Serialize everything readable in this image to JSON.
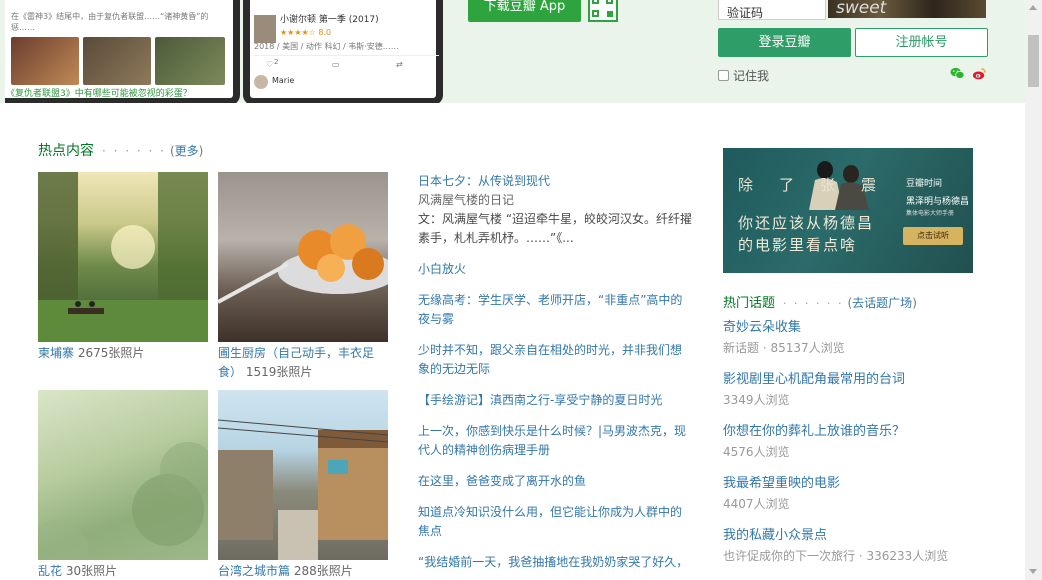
{
  "banner": {
    "phone_text_1": "在《雷神3》结尾中，由于复仇者联盟……“诸神黄昏”的惩……",
    "phone_caption": "《复仇者联盟3》中有哪些可能被忽视的彩蛋？",
    "show_title": "小谢尔顿 第一季 (2017)",
    "show_rating": "★★★★☆ 8.0",
    "show_meta": "2018 / 美国 / 动作 科幻 / 韦斯·安德……",
    "like_count": "2",
    "commenter": "Marie",
    "download_label": "下载豆瓣 App",
    "captcha_placeholder": "验证码",
    "captcha_image_text": "sweet",
    "login_label": "登录豆瓣",
    "register_label": "注册帐号",
    "remember_label": "记住我"
  },
  "hot": {
    "title": "热点内容",
    "dots": "· · · · · ·",
    "more": "更多",
    "albums": [
      {
        "name": "柬埔寨",
        "count": "2675张照片"
      },
      {
        "name": "圃生厨房（自己动手，丰衣足食）",
        "count": "1519张照片"
      },
      {
        "name": "乱花",
        "count": "30张照片"
      },
      {
        "name": "台湾之城市篇",
        "count": "288张照片"
      }
    ],
    "articles": [
      {
        "title": "日本七夕：从传说到现代",
        "author": "风满屋气楼的日记",
        "body": "文：风满屋气楼 “迢迢牵牛星，皎皎河汉女。纤纤擢素手，札札弄机杼。……”《..."
      },
      {
        "title": "小白放火"
      },
      {
        "title": "无缘高考：学生厌学、老师开店，“非重点”高中的夜与雾"
      },
      {
        "title": "少时并不知，跟父亲自在相处的时光，并非我们想象的无边无际"
      },
      {
        "title": "【手绘游记】滇西南之行-享受宁静的夏日时光"
      },
      {
        "title": "上一次，你感到快乐是什么时候？|马男波杰克，现代人的精神创伤病理手册"
      },
      {
        "title": "在这里，爸爸变成了离开水的鱼"
      },
      {
        "title": "知道点冷知识没什么用，但它能让你成为人群中的焦点"
      },
      {
        "title": "“我结婚前一天，我爸抽搐地在我奶奶家哭了好久，"
      }
    ]
  },
  "ad": {
    "chars": "除了张震",
    "line1": "你还应该从杨德昌",
    "line2": "的电影里看点啥",
    "brand": "豆瓣时间",
    "desc1": "黑泽明与杨德昌",
    "desc2": "集体电影大师手册",
    "cta": "点击试听"
  },
  "topics": {
    "title": "热门话题",
    "dots": "· · · · · ·",
    "more": "去话题广场",
    "items": [
      {
        "title": "奇妙云朵收集",
        "meta": "新话题 · 85137人浏览"
      },
      {
        "title": "影视剧里心机配角最常用的台词",
        "meta": "3349人浏览"
      },
      {
        "title": "你想在你的葬礼上放谁的音乐？",
        "meta": "4576人浏览"
      },
      {
        "title": "我最希望重映的电影",
        "meta": "4407人浏览"
      },
      {
        "title": "我的私藏小众景点",
        "meta": "也许促成你的下一次旅行 · 336233人浏览"
      }
    ]
  },
  "colors": {
    "link": "#3377aa",
    "green": "#007722",
    "button_green": "#2e9d67",
    "banner_bg": "#eaf4ea"
  },
  "icons": [
    "wechat-icon",
    "weibo-icon",
    "qr-code-icon"
  ]
}
